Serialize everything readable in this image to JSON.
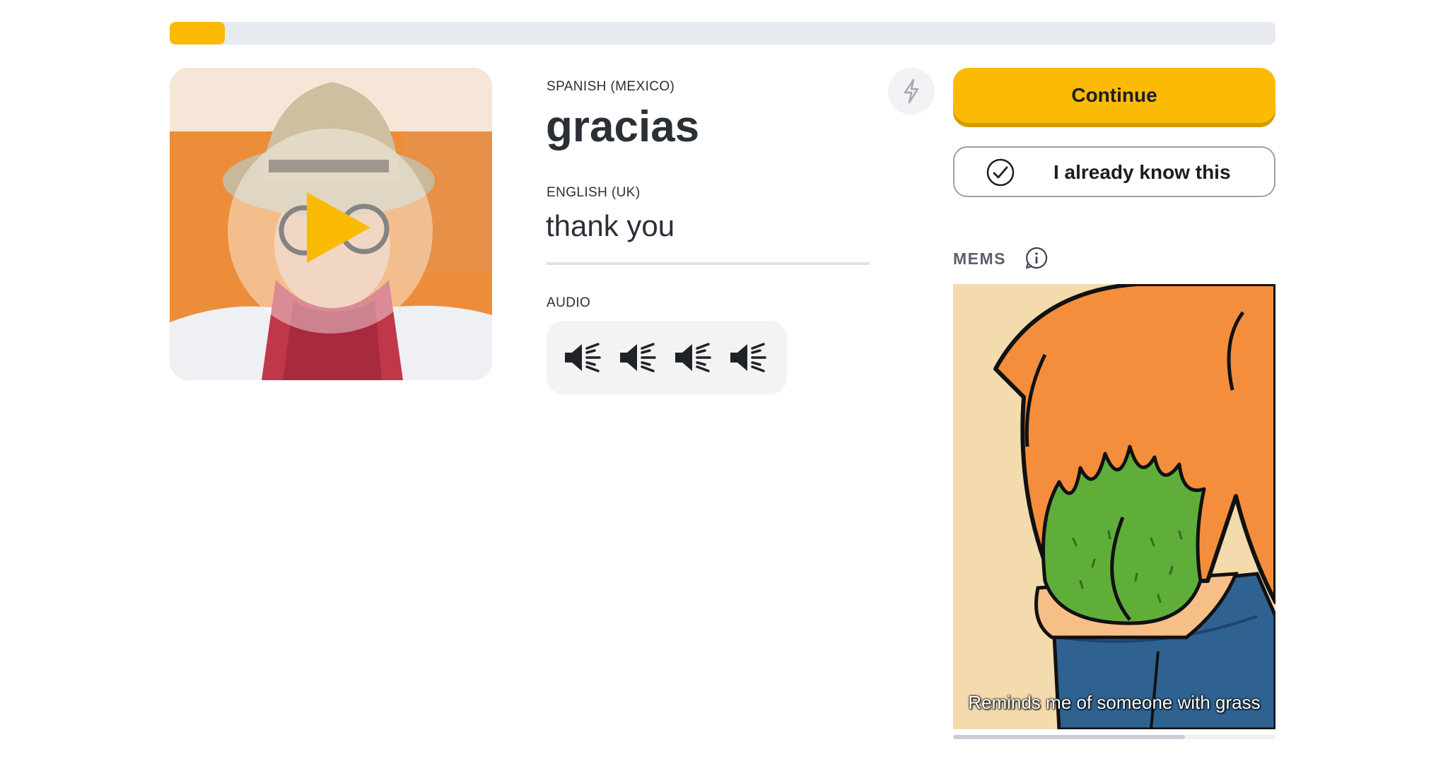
{
  "progress": {
    "fraction": 0.05
  },
  "video": {
    "play_icon": "play-icon"
  },
  "word": {
    "learn_language": "SPANISH (MEXICO)",
    "learn_text": "gracias",
    "native_language": "ENGLISH (UK)",
    "native_text": "thank you"
  },
  "audio": {
    "label": "AUDIO",
    "players": [
      {
        "icon": "speaker-icon"
      },
      {
        "icon": "speaker-icon"
      },
      {
        "icon": "speaker-icon"
      },
      {
        "icon": "speaker-icon"
      }
    ]
  },
  "actions": {
    "bolt_icon": "lightning-icon",
    "continue_label": "Continue",
    "already_know_label": "I already know this"
  },
  "mems": {
    "heading": "MEMS",
    "caption": "Reminds me of someone with grass",
    "scroll_fraction": 0.72
  },
  "colors": {
    "accent": "#fbbb05",
    "track": "#e8eaf2"
  }
}
